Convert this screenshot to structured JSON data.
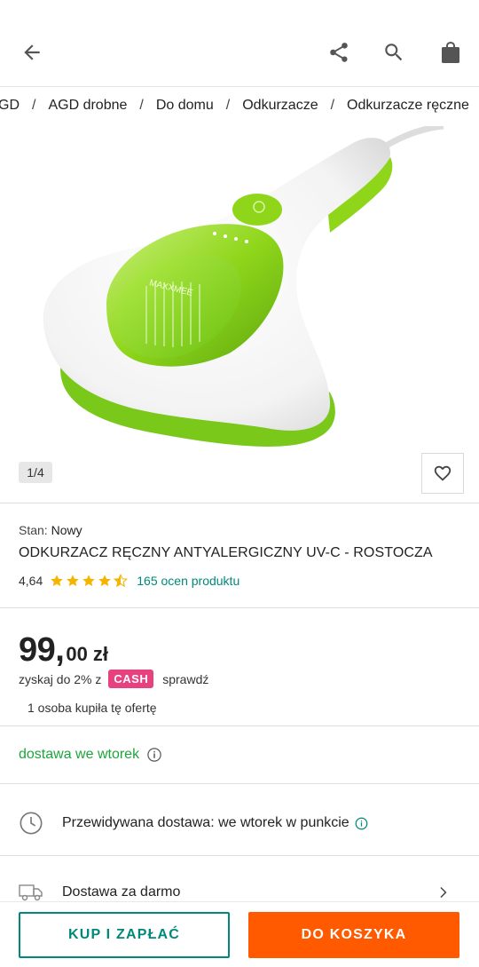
{
  "breadcrumb": [
    "GD",
    "AGD drobne",
    "Do domu",
    "Odkurzacze",
    "Odkurzacze ręczne"
  ],
  "gallery": {
    "counter": "1/4",
    "brand_text": "MAXXMEE"
  },
  "product": {
    "stan_label": "Stan:",
    "stan_value": "Nowy",
    "title": "ODKURZACZ RĘCZNY ANTYALERGICZNY UV-C - ROSTOCZA",
    "rating": "4,64",
    "rating_value": 4.64,
    "rating_max": 5,
    "reviews": "165 ocen produktu"
  },
  "price": {
    "integer": "99,",
    "decimal": "00 zł",
    "cashback_text": "zyskaj do 2% z",
    "cash_badge": "CASH",
    "cashback_link": "sprawdź",
    "bought": "1 osoba kupiła tę ofertę"
  },
  "delivery": {
    "headline": "dostawa we wtorek",
    "expected": "Przewidywana dostawa: we wtorek w punkcie",
    "free": "Dostawa za darmo"
  },
  "actions": {
    "buy": "KUP I ZAPŁAĆ",
    "cart": "DO KOSZYKA"
  },
  "colors": {
    "teal": "#00897b",
    "orange": "#ff5a00",
    "green": "#1ea43c",
    "cash": "#e8417f",
    "star": "#f5b400"
  }
}
